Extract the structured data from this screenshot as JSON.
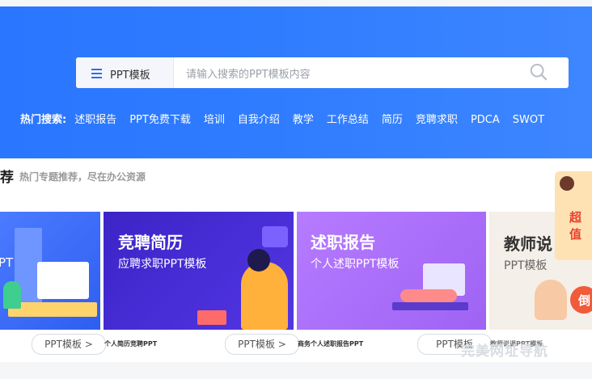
{
  "search": {
    "category_label": "PPT模板",
    "placeholder": "请输入搜索的PPT模板内容"
  },
  "hot_search": {
    "label": "热门搜索:",
    "keywords": [
      "述职报告",
      "PPT免费下载",
      "培训",
      "自我介绍",
      "教学",
      "工作总结",
      "简历",
      "竞聘求职",
      "PDCA",
      "SWOT"
    ]
  },
  "section": {
    "title": "荐",
    "subtitle": "热门专题推荐，尽在办公资源"
  },
  "cards": [
    {
      "title": "",
      "subtitle": "PT",
      "color": "#3d6bff"
    },
    {
      "title": "竞聘简历",
      "subtitle": "应聘求职PPT模板",
      "color": "#4a2fd8"
    },
    {
      "title": "述职报告",
      "subtitle": "个人述职PPT模板",
      "color": "#b07cff"
    },
    {
      "title": "教师说",
      "subtitle": "PPT模板",
      "color": "#f2ece6"
    }
  ],
  "pills": [
    "PPT模板 >",
    "PPT模板 >",
    "PPT模板"
  ],
  "captions": [
    "个人简历竞聘PPT",
    "商务个人述职报告PPT",
    "教师说课PPT模板"
  ],
  "promo": {
    "text": "超值",
    "badge": "倒"
  },
  "watermark": "完美网址导航"
}
